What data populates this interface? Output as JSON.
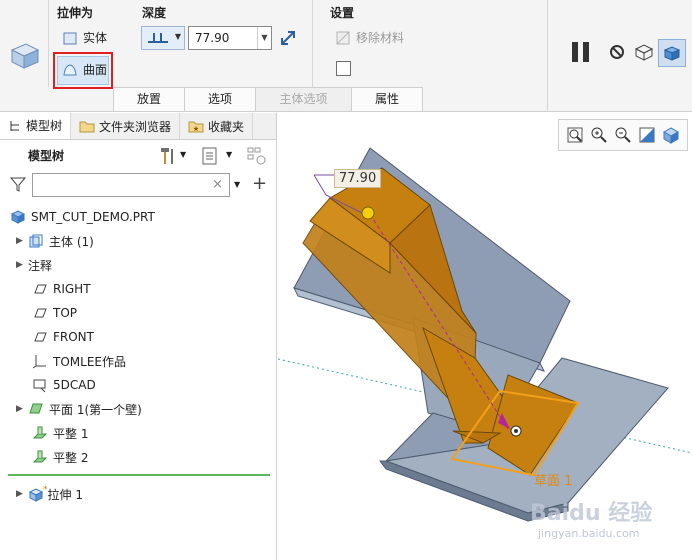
{
  "ribbon": {
    "extrude_as_title": "拉伸为",
    "solid_label": "实体",
    "surface_label": "曲面",
    "depth_title": "深度",
    "depth_value": "77.90",
    "settings_title": "设置",
    "remove_material_label": "移除材料"
  },
  "tabs": [
    {
      "label": "放置"
    },
    {
      "label": "选项"
    },
    {
      "label": "主体选项"
    },
    {
      "label": "属性"
    }
  ],
  "left_tabs": [
    {
      "label": "模型树"
    },
    {
      "label": "文件夹浏览器"
    },
    {
      "label": "收藏夹"
    }
  ],
  "tree": {
    "header": "模型树",
    "filter_placeholder": "",
    "items": [
      {
        "label": "SMT_CUT_DEMO.PRT"
      },
      {
        "label": "主体 (1)"
      },
      {
        "label": "注释"
      },
      {
        "label": "RIGHT"
      },
      {
        "label": "TOP"
      },
      {
        "label": "FRONT"
      },
      {
        "label": "TOMLEE作品"
      },
      {
        "label": "5DCAD"
      },
      {
        "label": "平面 1(第一个壁)"
      },
      {
        "label": "平整 1"
      },
      {
        "label": "平整 2"
      },
      {
        "label": "拉伸 1"
      }
    ]
  },
  "viewport": {
    "dimension_value": "77.90",
    "sketch_label": "草面 1",
    "watermark": "Baidu 经验",
    "watermark_url": "jingyan.baidu.com"
  },
  "colors": {
    "accent_blue": "#3a78c3",
    "orange_body": "#c6800f",
    "gray_sheet": "#8e9db3",
    "highlight_red": "#e02020"
  }
}
